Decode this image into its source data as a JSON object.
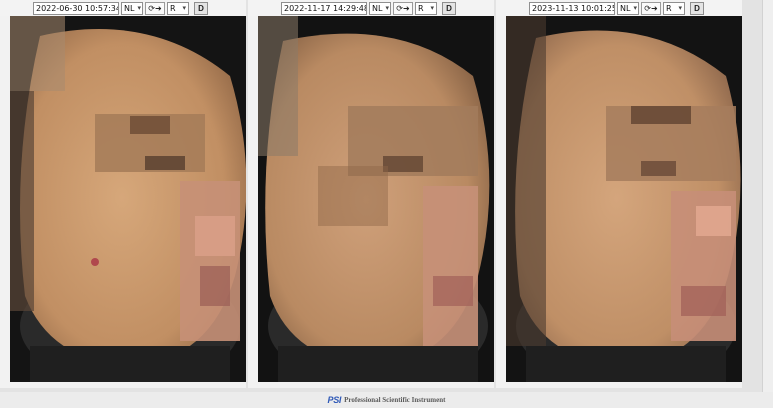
{
  "panels": [
    {
      "date": "2022-06-30 10:57:34",
      "mode": "NL",
      "rotation": "R",
      "button": "D"
    },
    {
      "date": "2022-11-17 14:29:48",
      "mode": "NL",
      "rotation": "R",
      "button": "D"
    },
    {
      "date": "2023-11-13 10:01:25",
      "mode": "NL",
      "rotation": "R",
      "button": "D"
    }
  ],
  "footer": {
    "logo": "PSI",
    "text": "Professional Scientific Instrument"
  },
  "icons": {
    "dropdown": "chevron-down-icon",
    "rotate": "rotate-arrow-icon"
  },
  "colors": {
    "skin": "#c99a6e",
    "background": "#111111",
    "logo": "#2f59b7"
  }
}
